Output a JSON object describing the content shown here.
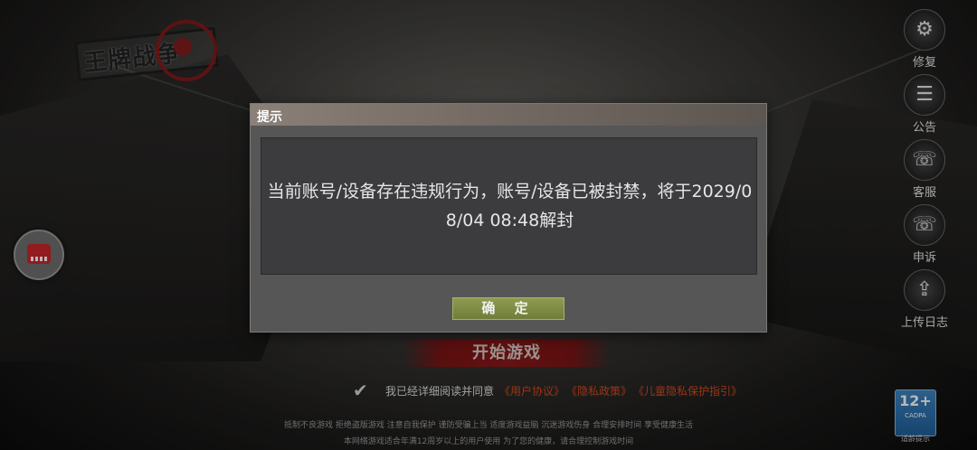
{
  "logo": {
    "text": "王牌战争"
  },
  "right_menu": [
    {
      "label": "修复",
      "icon": "gear-icon",
      "glyph": "⚙"
    },
    {
      "label": "公告",
      "icon": "notice-icon",
      "glyph": "☰"
    },
    {
      "label": "客服",
      "icon": "headset-icon",
      "glyph": "☏"
    },
    {
      "label": "申诉",
      "icon": "headset-icon",
      "glyph": "☏"
    },
    {
      "label": "上传日志",
      "icon": "upload-icon",
      "glyph": "⇪"
    }
  ],
  "start_button": {
    "label": "开始游戏"
  },
  "agreement": {
    "checked": true,
    "text": "我已经详细阅读并同意",
    "links": [
      "《用户协议》",
      "《隐私政策》",
      "《儿童隐私保护指引》"
    ]
  },
  "health_notice": {
    "line1": "抵制不良游戏 拒绝盗版游戏 注意自我保护 谨防受骗上当 适度游戏益脑 沉迷游戏伤身 合理安排时间 享受健康生活",
    "line2": "本网络游戏适合年满12周岁以上的用户使用   为了您的健康，请合理控制游戏时间"
  },
  "age_rating": {
    "number": "12+",
    "org": "CADPA",
    "tip": "适龄提示"
  },
  "dialog": {
    "title": "提示",
    "message": "当前账号/设备存在违规行为，账号/设备已被封禁，将于2029/08/04 08:48解封",
    "confirm_label": "确 定"
  },
  "colors": {
    "accent_green": "#7a883f",
    "link_orange": "#d8491d",
    "start_red": "#8a1818"
  }
}
